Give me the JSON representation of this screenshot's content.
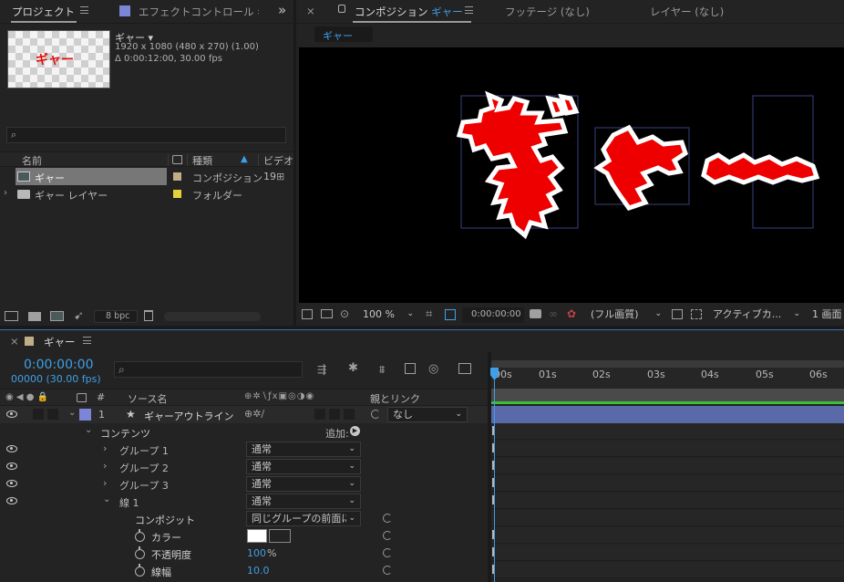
{
  "project": {
    "tab_label": "プロジェクト",
    "effects_tab_label": "エフェクトコントロール ギ",
    "expand_glyph": "»",
    "selected_name": "ギャー ▾",
    "selected_dims": "1920 x 1080  (480 x 270) (1.00)",
    "selected_duration": "Δ 0:00:12:00, 30.00 fps",
    "thumb_text": "ギャー",
    "search_placeholder": "",
    "col_name": "名前",
    "col_type": "種類",
    "col_video": "ビデオ",
    "items": [
      {
        "name": "ギャー",
        "type": "コンポジション",
        "extra": "19",
        "label_color": "#bfae87"
      },
      {
        "name": "ギャー レイヤー",
        "type": "フォルダー",
        "extra": "",
        "label_color": "#e6d23a"
      }
    ],
    "bpc": "8 bpc"
  },
  "composition": {
    "tab_label_prefix": "コンポジション",
    "tab_label_name": "ギャー",
    "footage_tab": "フッテージ (なし)",
    "layer_tab": "レイヤー (なし)",
    "comp_chip": "ギャー",
    "canvas_text": "ギャー",
    "zoom": "100 %",
    "timecode": "0:00:00:00",
    "resolution": "(フル画質)",
    "camera": "アクティブカ...",
    "views": "1 画面"
  },
  "timeline": {
    "tab_label": "ギャー",
    "current_time": "0:00:00:00",
    "frame_info": "00000 (30.00 fps)",
    "search_placeholder": "",
    "col_hash": "#",
    "col_source": "ソース名",
    "col_parent": "親とリンク",
    "ruler": [
      "00s",
      "01s",
      "02s",
      "03s",
      "04s",
      "05s",
      "06s"
    ],
    "layer": {
      "index": "1",
      "name": "ギャーアウトライン",
      "parent": "なし",
      "label_color": "#7b86d9"
    },
    "contents_label": "コンテンツ",
    "add_label": "追加:",
    "groups": [
      {
        "name": "グループ 1",
        "mode": "通常"
      },
      {
        "name": "グループ 2",
        "mode": "通常"
      },
      {
        "name": "グループ 3",
        "mode": "通常"
      },
      {
        "name": "線 1",
        "mode": "通常"
      }
    ],
    "composite_label": "コンポジット",
    "composite_value": "同じグループの前面に",
    "color_label": "カラー",
    "stroke_color": "#ffffff",
    "opacity_label": "不透明度",
    "opacity_value": "100",
    "opacity_unit": "%",
    "width_label": "線幅",
    "width_value": "10.0",
    "work_area_color": "#5a6aa8",
    "track_color": "#3ac03a"
  }
}
